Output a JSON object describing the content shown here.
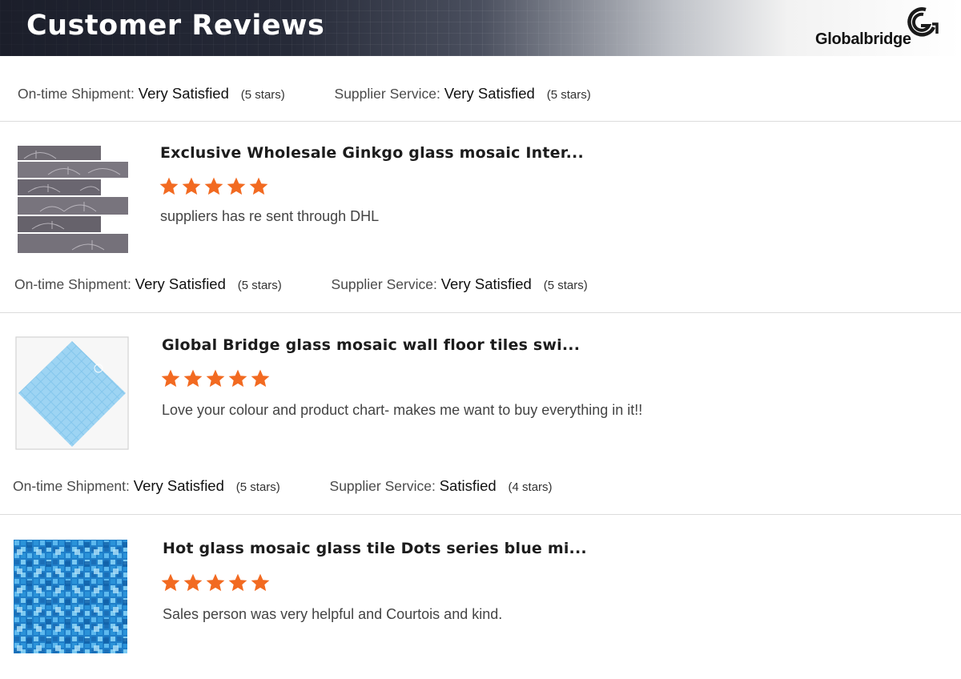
{
  "header": {
    "title": "Customer Reviews",
    "logo_text": "Globalbridge"
  },
  "colors": {
    "star": "#f26a21",
    "banner_dark": "#1b1e2a"
  },
  "ratings": [
    {
      "shipment_label": "On-time Shipment:",
      "shipment_value": "Very Satisfied",
      "shipment_stars": "(5 stars)",
      "service_label": "Supplier Service:",
      "service_value": "Very Satisfied",
      "service_stars": "(5 stars)"
    },
    {
      "shipment_label": "On-time Shipment:",
      "shipment_value": "Very Satisfied",
      "shipment_stars": "(5 stars)",
      "service_label": "Supplier Service:",
      "service_value": "Very Satisfied",
      "service_stars": "(5 stars)"
    },
    {
      "shipment_label": "On-time Shipment:",
      "shipment_value": "Very Satisfied",
      "shipment_stars": "(5 stars)",
      "service_label": "Supplier Service:",
      "service_value": "Satisfied",
      "service_stars": "(4 stars)"
    }
  ],
  "reviews": [
    {
      "title": "Exclusive Wholesale Ginkgo glass mosaic Inter...",
      "stars": 5,
      "comment": "suppliers has re sent through DHL",
      "thumb_icon": "ginkgo-glass-mosaic-image"
    },
    {
      "title": "Global Bridge glass mosaic wall floor tiles swi...",
      "stars": 5,
      "comment": "Love your colour and product chart- makes me want to buy everything in it!!",
      "thumb_icon": "blue-mosaic-sheet-image"
    },
    {
      "title": "Hot glass mosaic glass tile Dots series blue mi...",
      "stars": 5,
      "comment": "Sales person was very helpful and  Courtois and kind.",
      "thumb_icon": "dots-blue-mosaic-image"
    }
  ]
}
